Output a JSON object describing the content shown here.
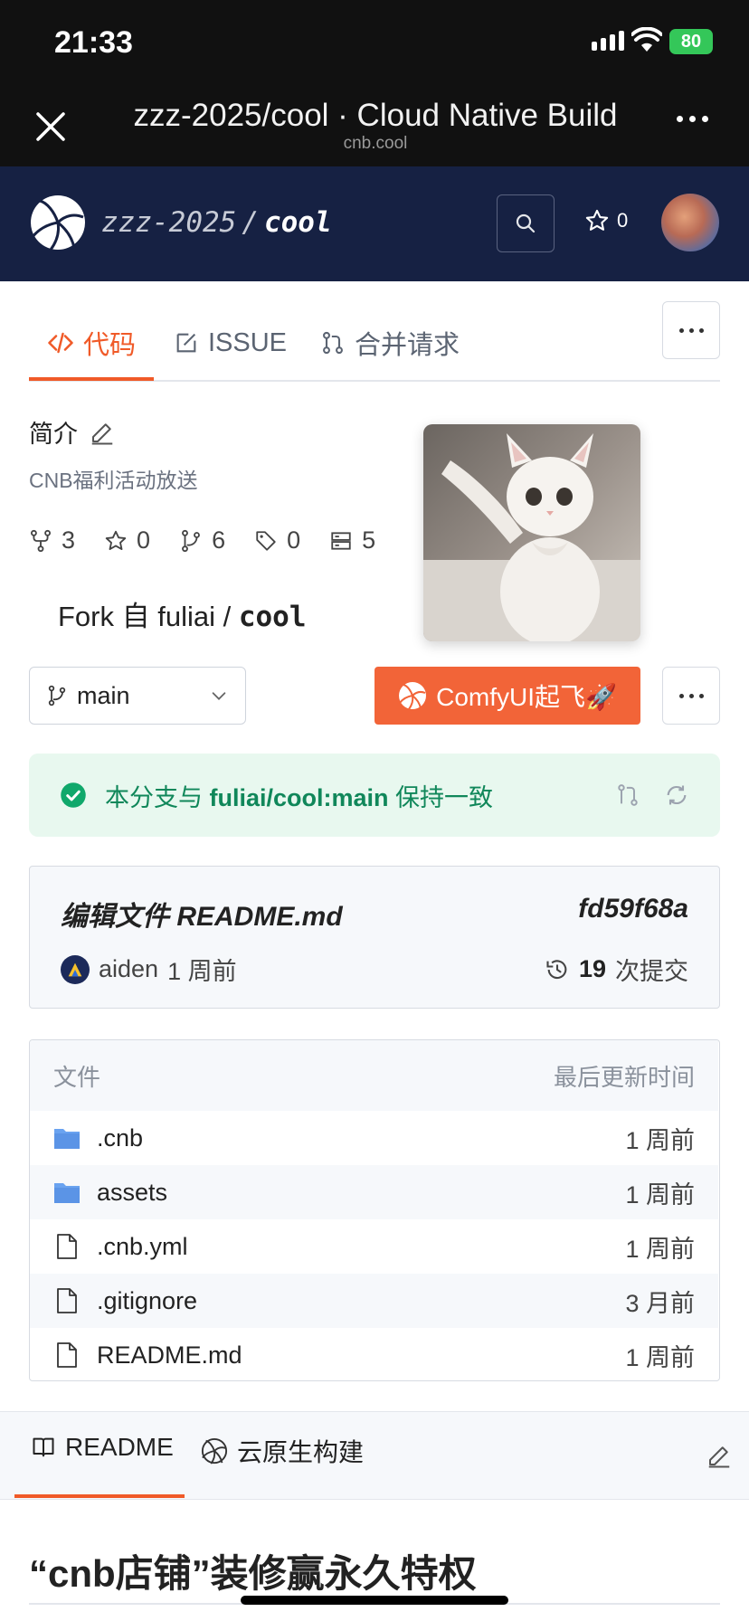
{
  "status": {
    "time": "21:33",
    "battery": "80"
  },
  "browser": {
    "title": "zzz-2025/cool · Cloud Native Build",
    "domain": "cnb.cool"
  },
  "header": {
    "owner": "zzz-2025",
    "separator": "/",
    "repo": "cool",
    "stars": "0"
  },
  "tabs": [
    {
      "label": "代码",
      "icon": "code-icon"
    },
    {
      "label": "ISSUE",
      "icon": "issue-icon"
    },
    {
      "label": "合并请求",
      "icon": "pull-request-icon"
    }
  ],
  "intro": {
    "title": "简介",
    "description": "CNB福利活动放送"
  },
  "stats": {
    "forks": "3",
    "stars": "0",
    "branches": "6",
    "tags": "0",
    "releases": "5"
  },
  "fork": {
    "prefix": "Fork 自 fuliai / ",
    "repo": "cool"
  },
  "branch": {
    "name": "main"
  },
  "promo_button": {
    "label": "ComfyUI起飞🚀"
  },
  "sync": {
    "text_prefix": "本分支与 ",
    "target": "fuliai/cool:main",
    "text_suffix": " 保持一致"
  },
  "commit": {
    "message": "编辑文件 README.md",
    "hash": "fd59f68a",
    "author": "aiden",
    "time": "1 周前",
    "count": "19",
    "count_label": "次提交"
  },
  "files": {
    "header_name": "文件",
    "header_time": "最后更新时间",
    "rows": [
      {
        "name": ".cnb",
        "type": "folder",
        "time": "1 周前"
      },
      {
        "name": "assets",
        "type": "folder",
        "time": "1 周前"
      },
      {
        "name": ".cnb.yml",
        "type": "file",
        "time": "1 周前"
      },
      {
        "name": ".gitignore",
        "type": "file",
        "time": "3 月前"
      },
      {
        "name": "README.md",
        "type": "file",
        "time": "1 周前"
      }
    ]
  },
  "readme": {
    "tab_readme": "README",
    "tab_build": "云原生构建",
    "heading": "“cnb店铺”装修赢永久特权"
  },
  "colors": {
    "accent": "#f05a28",
    "header_bg": "#162143",
    "success": "#10875a"
  }
}
